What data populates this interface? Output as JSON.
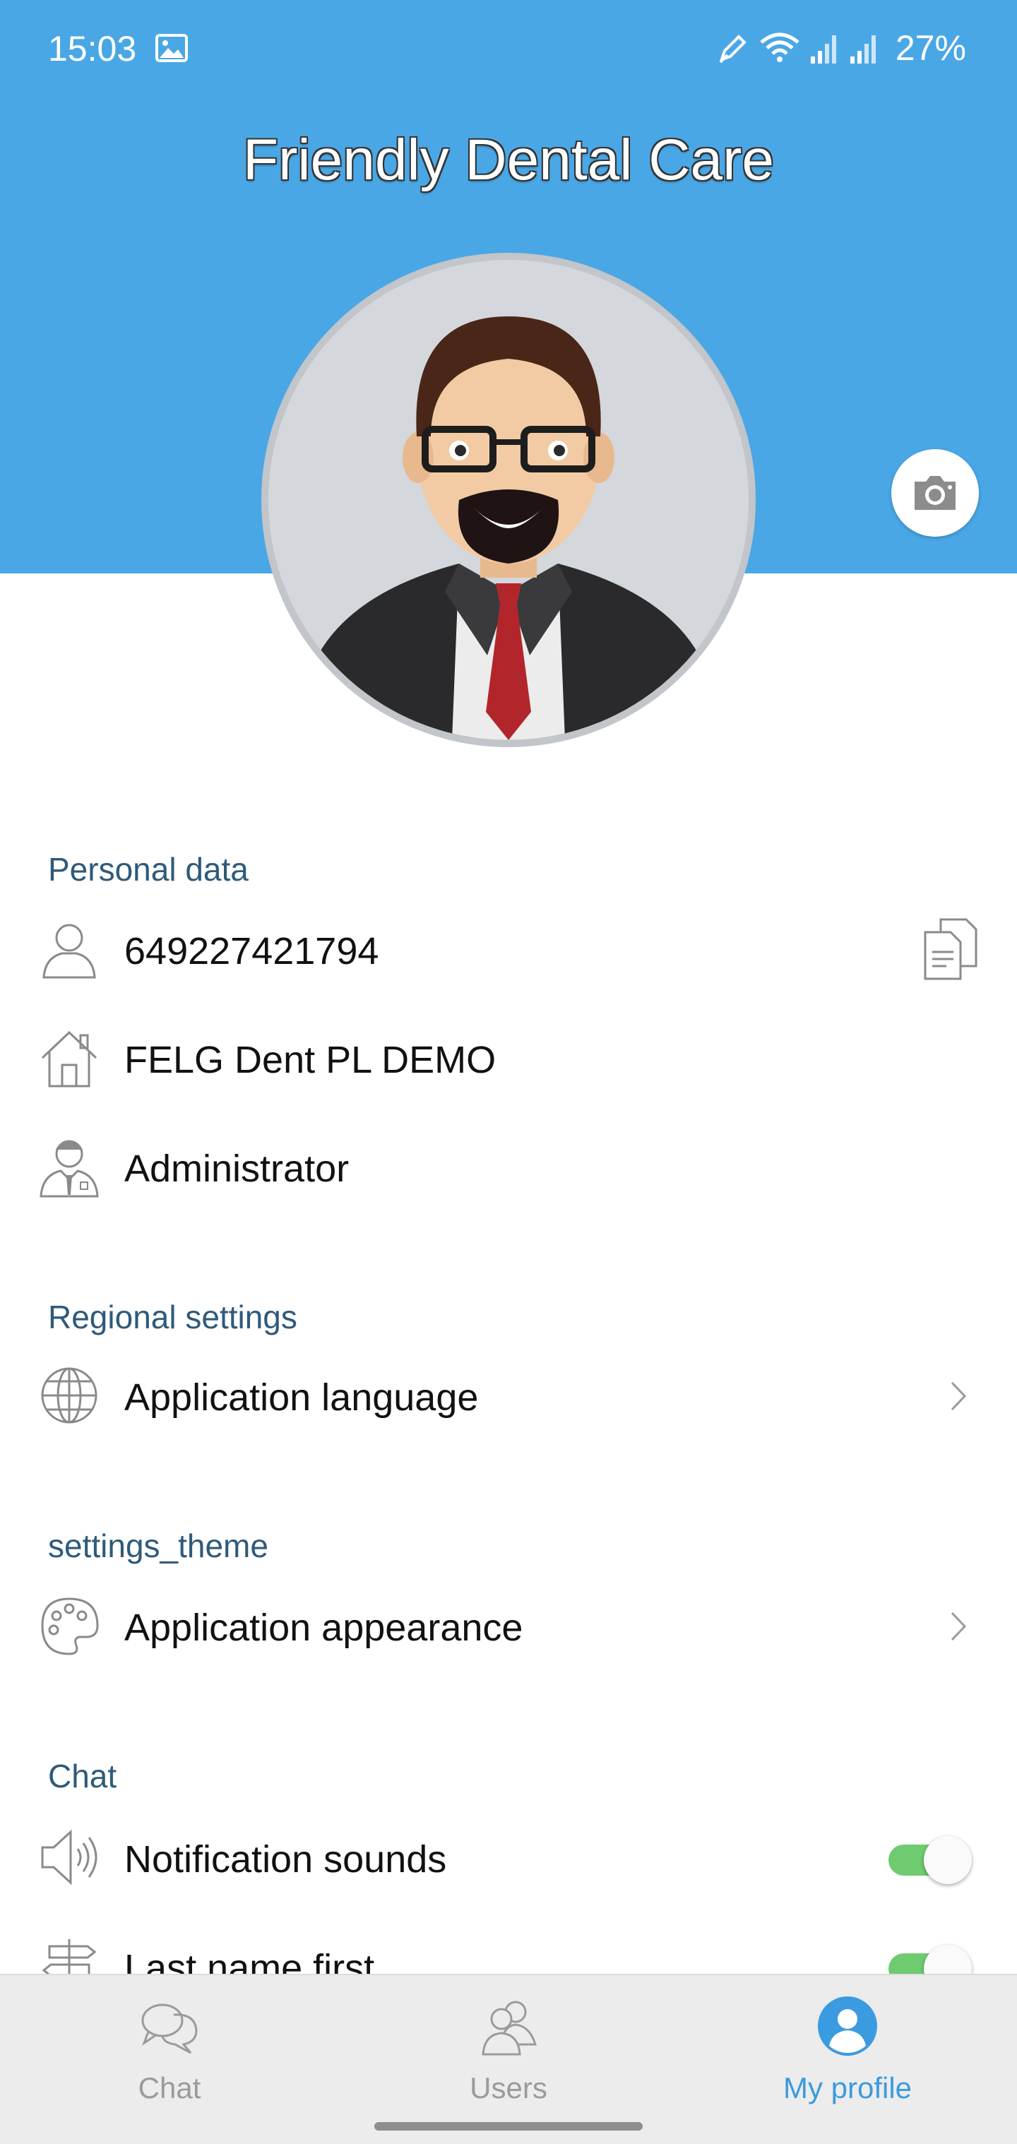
{
  "status_bar": {
    "time": "15:03",
    "battery": "27%",
    "icons": [
      "gallery-icon",
      "pen-icon",
      "wifi-icon",
      "signal-icon",
      "signal-icon"
    ]
  },
  "header": {
    "title": "Friendly Dental Care",
    "background_color": "#4aa7e5",
    "camera_icon": "camera-icon"
  },
  "sections": {
    "personal": {
      "title": "Personal data",
      "id_value": "649227421794",
      "clinic_value": "FELG Dent PL DEMO",
      "role_value": "Administrator"
    },
    "regional": {
      "title": "Regional settings",
      "language_label": "Application language"
    },
    "theme": {
      "title": "settings_theme",
      "appearance_label": "Application appearance"
    },
    "chat": {
      "title": "Chat",
      "notification_sounds_label": "Notification sounds",
      "notification_sounds_on": true,
      "last_name_first_label": "Last name first",
      "last_name_first_on": true
    }
  },
  "bottom_nav": {
    "chat_label": "Chat",
    "users_label": "Users",
    "profile_label": "My profile",
    "active": "My profile",
    "active_color": "#3b9be0",
    "inactive_color": "#9b9b9b"
  },
  "toggle_on_color": "#6fcb6f"
}
